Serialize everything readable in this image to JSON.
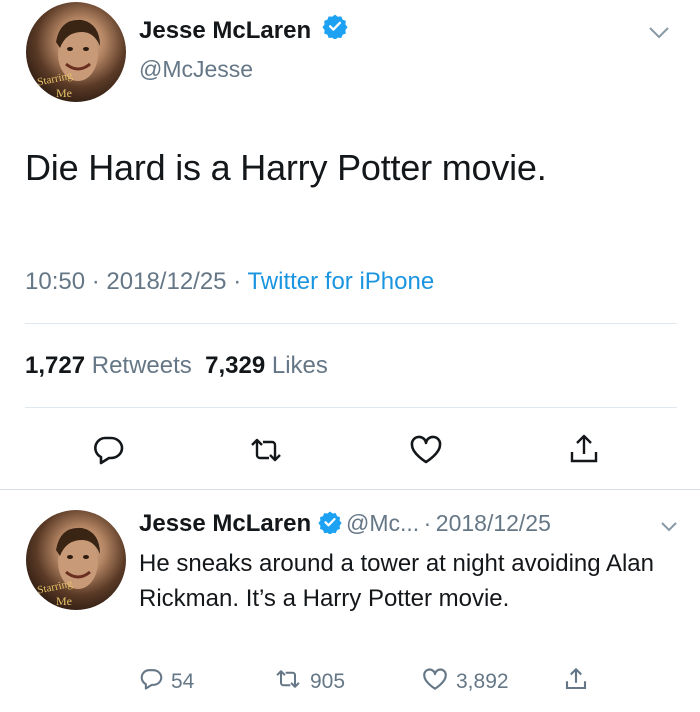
{
  "main_tweet": {
    "author_name": "Jesse McLaren",
    "handle": "@McJesse",
    "avatar_badge_text": "Starring Me",
    "text": "Die Hard is a Harry Potter movie.",
    "time": "10:50",
    "separator": "·",
    "date": "2018/12/25",
    "source": "Twitter for iPhone",
    "retweets_count": "1,727",
    "retweets_label": "Retweets",
    "likes_count": "7,329",
    "likes_label": "Likes",
    "actions": [
      "reply-icon",
      "retweet-icon",
      "like-icon",
      "share-icon"
    ]
  },
  "reply_tweet": {
    "author_name": "Jesse McLaren",
    "handle_truncated": "@Mc...",
    "separator": "·",
    "date": "2018/12/25",
    "text": "He sneaks around a tower at night avoiding Alan Rickman. It’s a Harry Potter movie.",
    "reply_count": "54",
    "retweet_count": "905",
    "like_count": "3,892"
  },
  "colors": {
    "verified": "#1da1f2",
    "secondary_text": "#657786",
    "link": "#1b95e0",
    "divider": "#e1e8ed"
  }
}
